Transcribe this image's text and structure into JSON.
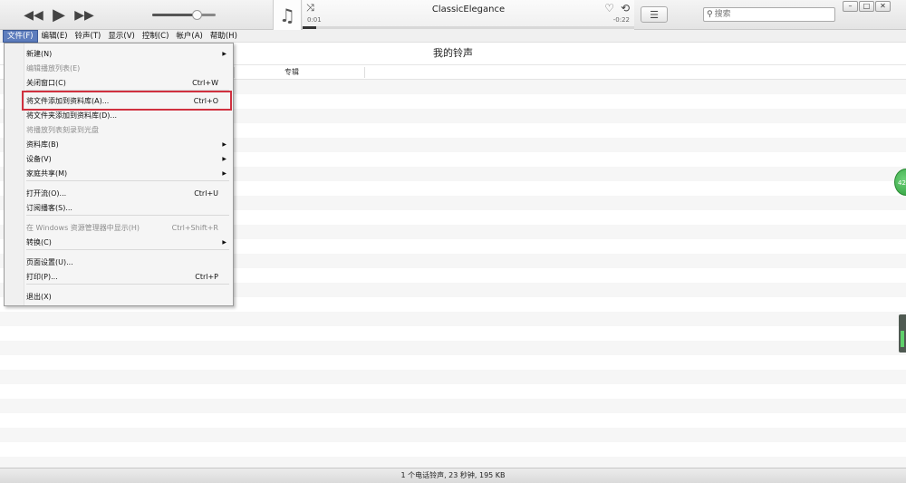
{
  "player": {
    "controls": {
      "prev_icon": "◀◀",
      "play_icon": "▶",
      "next_icon": "▶▶"
    },
    "volume_level": 0.7,
    "now_playing": {
      "title": "ClassicElegance",
      "elapsed": "0:01",
      "remaining": "-0:22",
      "progress": 0.04,
      "shuffle_icon": "⤨",
      "heart_icon": "♡",
      "repeat_icon": "⟲"
    },
    "art_icon": "♫",
    "list_view_icon": "☰",
    "search": {
      "placeholder": "搜索",
      "value": "",
      "icon": "⚲"
    },
    "window_buttons": {
      "minimize": "–",
      "maximize": "□",
      "close": "✕"
    }
  },
  "menubar": [
    {
      "label": "文件(F)",
      "active": true
    },
    {
      "label": "编辑(E)"
    },
    {
      "label": "铃声(T)"
    },
    {
      "label": "显示(V)"
    },
    {
      "label": "控制(C)"
    },
    {
      "label": "帐户(A)"
    },
    {
      "label": "帮助(H)"
    }
  ],
  "content": {
    "title": "我的铃声",
    "columns": [
      "专辑"
    ]
  },
  "file_menu": {
    "items": [
      {
        "label": "新建(N)",
        "submenu": true
      },
      {
        "label": "编辑播放列表(E)",
        "disabled": true
      },
      {
        "label": "关闭窗口(C)",
        "shortcut": "Ctrl+W"
      },
      {
        "separator": true
      },
      {
        "label": "将文件添加到资料库(A)...",
        "shortcut": "Ctrl+O",
        "highlighted": true
      },
      {
        "label": "将文件夹添加到资料库(D)..."
      },
      {
        "label": "将播放列表刻录到光盘",
        "disabled": true
      },
      {
        "label": "资料库(B)",
        "submenu": true
      },
      {
        "label": "设备(V)",
        "submenu": true
      },
      {
        "label": "家庭共享(M)",
        "submenu": true
      },
      {
        "separator": true
      },
      {
        "label": "打开流(O)...",
        "shortcut": "Ctrl+U"
      },
      {
        "label": "订阅播客(S)..."
      },
      {
        "separator": true
      },
      {
        "label": "在 Windows 资源管理器中显示(H)",
        "shortcut": "Ctrl+Shift+R",
        "disabled": true
      },
      {
        "label": "转换(C)",
        "submenu": true
      },
      {
        "separator": true
      },
      {
        "label": "页面设置(U)..."
      },
      {
        "label": "打印(P)...",
        "shortcut": "Ctrl+P"
      },
      {
        "separator": true
      },
      {
        "label": "退出(X)"
      }
    ]
  },
  "side_bubble_text": "42",
  "status_bar": "1 个电话铃声, 23 秒钟, 195 KB",
  "colors": {
    "menu_active": "#5d7dbd",
    "highlight_box": "#d0313f",
    "bubble": "#2b9e3a"
  }
}
